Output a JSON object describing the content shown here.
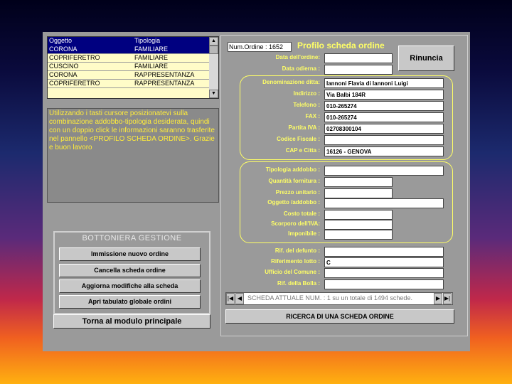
{
  "list": {
    "headers": [
      "Oggetto",
      "Tipologia"
    ],
    "rows": [
      [
        "CORONA",
        "FAMILIARE"
      ],
      [
        "COPRIFERETRO",
        "FAMILIARE"
      ],
      [
        "CUSCINO",
        "FAMILIARE"
      ],
      [
        "CORONA",
        "RAPPRESENTANZA"
      ],
      [
        "COPRIFERETRO",
        "RAPPRESENTANZA"
      ]
    ],
    "selected_index": 0
  },
  "hint_text": "Utilizzando i tasti cursore posizionatevi sulla combinazione addobbo-tipologia desiderata, quindi con un doppio click le informazioni saranno trasferite nel pannello <PROFILO SCHEDA ORDINE>. Grazie e buon lavoro",
  "bottoniera": {
    "title": "BOTTONIERA GESTIONE",
    "buttons": [
      "Immissione nuovo ordine",
      "Cancella scheda ordine",
      "Aggiorna modifiche alla scheda",
      "Apri tabulato globale ordini"
    ]
  },
  "main_button": "Torna al modulo principale",
  "panel": {
    "num_ordine": "Num.Ordine : 1652",
    "title": "Profilo scheda ordine",
    "rinuncia": "Rinuncia",
    "top_fields": [
      {
        "label": "Data dell'ordine:",
        "value": ""
      },
      {
        "label": "Data odierna :",
        "value": ""
      }
    ],
    "ditta_fields": [
      {
        "label": "Denominazione ditta:",
        "value": "Iannoni Flavia di Iannoni Luigi"
      },
      {
        "label": "Indirizzo :",
        "value": "Via Balbi 184R"
      },
      {
        "label": "Telefono :",
        "value": "010-265274"
      },
      {
        "label": "FAX :",
        "value": "010-265274"
      },
      {
        "label": "Partita IVA :",
        "value": "02708300104"
      },
      {
        "label": "Codice Fiscale :",
        "value": ""
      },
      {
        "label": "CAP e Citta :",
        "value": "16126 - GENOVA"
      }
    ],
    "addobbo_fields": [
      {
        "label": "Tipologia addobbo :",
        "value": ""
      },
      {
        "label": "Quantità fornitura :",
        "value": ""
      },
      {
        "label": "Prezzo unitario :",
        "value": ""
      },
      {
        "label": "Oggetto /addobbo :",
        "value": ""
      },
      {
        "label": "Costo totale :",
        "value": ""
      },
      {
        "label": "Scorporo dell'IVA:",
        "value": ""
      },
      {
        "label": "Imponibile :",
        "value": ""
      }
    ],
    "defunto_fields": [
      {
        "label": "Rif. del defunto :",
        "value": ""
      },
      {
        "label": "Riferimento lotto :",
        "value": "C"
      },
      {
        "label": "Ufficio del Comune :",
        "value": ""
      },
      {
        "label": "Rif. della Bolla :",
        "value": ""
      }
    ],
    "nav_text": "SCHEDA ATTUALE NUM. : 1 su un totale di  1494 schede.",
    "ricerca": "RICERCA DI UNA SCHEDA ORDINE"
  },
  "colors": {
    "label": "#ffff66",
    "selection": "#000080",
    "list_bg": "#fffcc8",
    "panel_bg": "#9a9a9a"
  }
}
